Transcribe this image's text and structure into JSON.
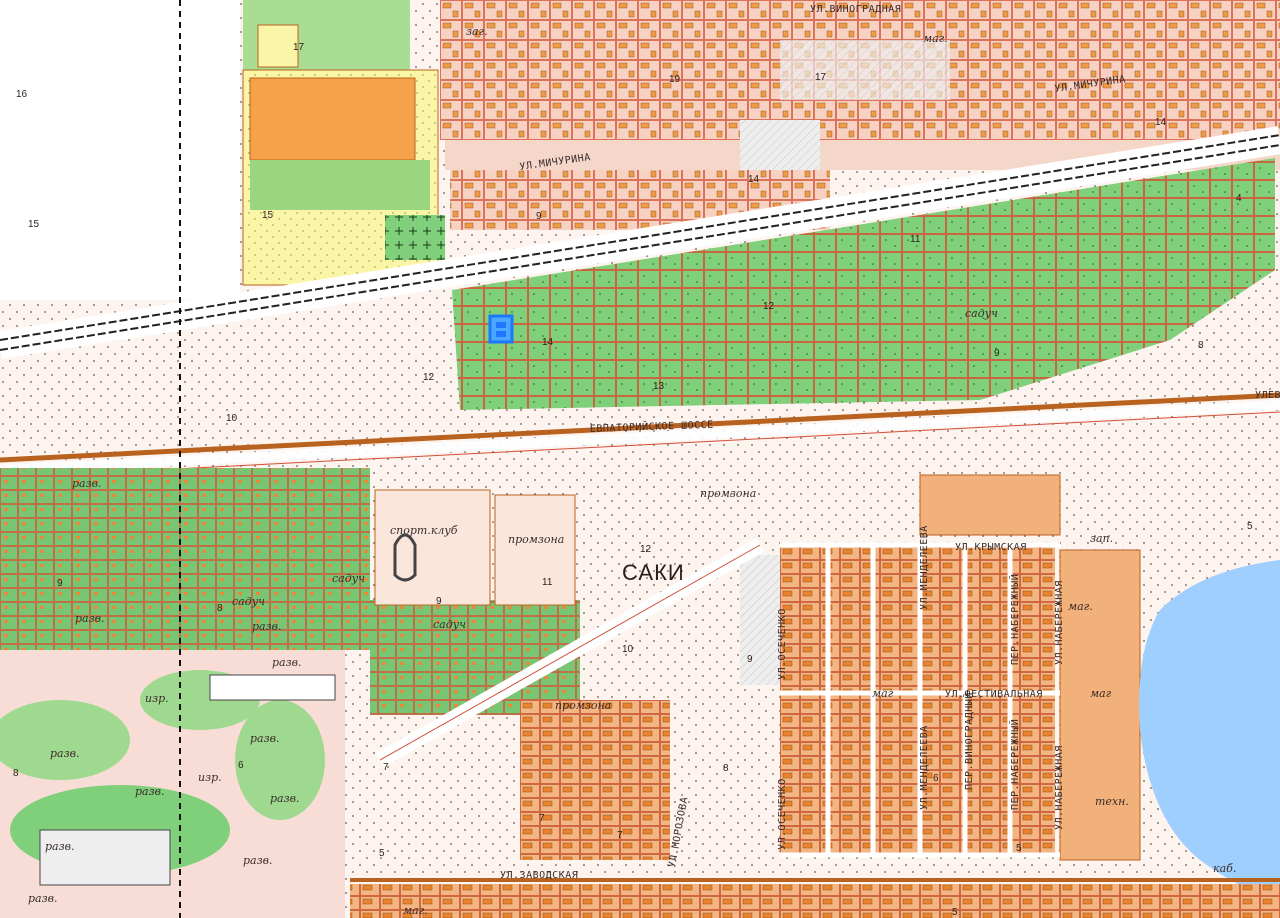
{
  "colors": {
    "background": "#fbeee8",
    "built_area": "#f6d3c4",
    "garden_green": "#7fcf7b",
    "light_green": "#b9e6a8",
    "yellow_field": "#fbf5a8",
    "building_orange": "#f0a050",
    "road_red": "#d24f3a",
    "road_brown": "#b9621f",
    "water": "#9fcfff",
    "gray_hatch": "#d9d9d9",
    "marker_blue": "#1e78ff"
  },
  "streets": {
    "vinogradnaya": "УЛ.ВИНОГРАДНАЯ",
    "michurina_top": "УЛ.МИЧУРИНА",
    "michurina_mid": "УЛ.МИЧУРИНА",
    "evpatoriyskoe": "ЕВПАТОРИЙСКОЕ ШОССЕ",
    "krymskaya": "УЛ.КРЫМСКАЯ",
    "festivalnaya": "УЛ.ФЕСТИВАЛЬНАЯ",
    "zavodskaya": "УЛ.ЗАВОДСКАЯ",
    "morozova": "УЛ.МОРОЗОВА",
    "kuchenko": "УЛ.ОСЕЧЕНКО",
    "kuchenko2": "УЛ.ОСЕЧЕНКО",
    "mendeleeva": "УЛ.МЕНДЕЛЕЕВА",
    "mendeleeva2": "УЛ.МЕНДЕЛЕЕВА",
    "naberezhnaya": "УЛ.НАБЕРЕЖНАЯ",
    "naberezhnaya2": "УЛ.НАБЕРЕЖНАЯ",
    "pernaberezhny": "ПЕР.НАБЕРЕЖНЫЙ",
    "pernaberezhny2": "ПЕР.НАБЕРЕЖНЫЙ",
    "pervoprohodny": "ПЕР.ВИНОГРАДНЫЙ",
    "ulev": "УЛЕВ"
  },
  "place": {
    "settlement": "САКИ"
  },
  "labels": {
    "zag": "заг.",
    "mag_top": "маг.",
    "sports_club": "спорт.клуб",
    "promzona_1": "промзона",
    "promzona_2": "промзона",
    "promzona_3": "промзона",
    "sad_1": "садуч",
    "sad_2": "садуч",
    "sad_3": "садуч",
    "sad_4": "садуч",
    "razv_1": "разв.",
    "razv_2": "разв.",
    "razv_3": "разв.",
    "razv_4": "разв.",
    "razv_5": "разв.",
    "razv_6": "разв.",
    "razv_7": "разв.",
    "razv_8": "разв.",
    "razv_9": "разв.",
    "razv_10": "разв.",
    "razv_11": "разв.",
    "izr_1": "изр.",
    "izr_2": "изр.",
    "mag_1": "маг",
    "mag_2": "маг",
    "mag_3": "маг.",
    "mag_4": "маг",
    "mag_5": "маг.",
    "zap": "зап.",
    "tekh": "техн.",
    "kab": "каб."
  },
  "numbers": {
    "n16": "16",
    "n15": "15",
    "n17": "17",
    "n15b": "15",
    "n12": "12",
    "n10": "10",
    "n14": "14",
    "n13": "13",
    "n12b": "12",
    "n11": "11",
    "n9": "9",
    "n19": "19",
    "n17b": "17",
    "n14b": "14",
    "n14c": "14",
    "n9b": "9",
    "n4": "4",
    "n9c": "9",
    "n8": "8",
    "n9d": "9",
    "n11b": "11",
    "n12c": "12",
    "n10b": "10",
    "n9e": "9",
    "n8b": "8",
    "n6": "6",
    "n8c": "8",
    "n7": "7",
    "n7b": "7",
    "n7c": "7",
    "n5": "5",
    "n6b": "6",
    "n5b": "5",
    "n5c": "5",
    "n5d": "5",
    "n8d": "8"
  },
  "marker": {
    "icon": "selected-parcel-marker-icon"
  }
}
